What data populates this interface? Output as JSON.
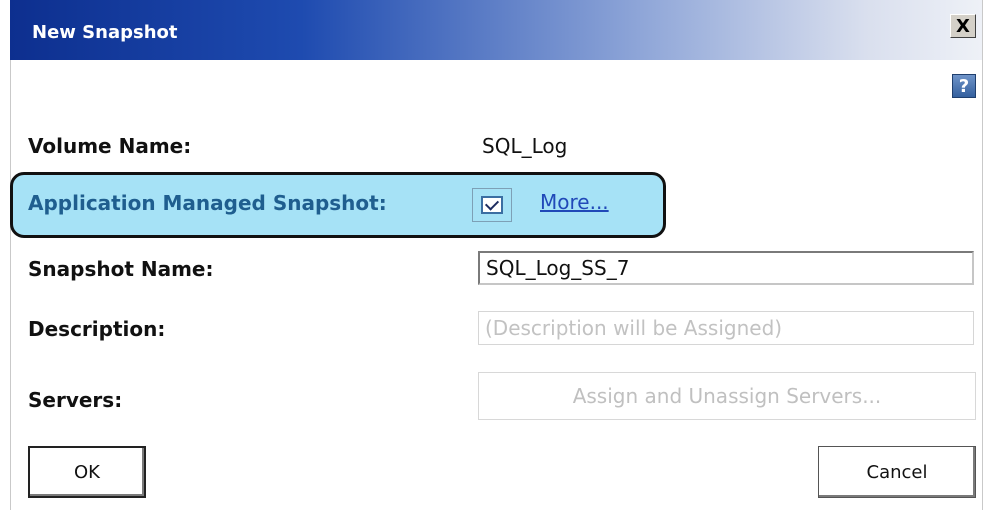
{
  "dialog": {
    "title": "New Snapshot",
    "close_label": "X",
    "help_label": "?"
  },
  "fields": {
    "volume_name": {
      "label": "Volume Name:",
      "value": "SQL_Log"
    },
    "app_managed": {
      "label": "Application Managed Snapshot:",
      "checked": true,
      "more_link": "More..."
    },
    "snapshot_name": {
      "label": "Snapshot Name:",
      "value": "SQL_Log_SS_7"
    },
    "description": {
      "label": "Description:",
      "placeholder": "(Description will be Assigned)"
    },
    "servers": {
      "label": "Servers:",
      "button_label": "Assign and Unassign Servers..."
    }
  },
  "buttons": {
    "ok": "OK",
    "cancel": "Cancel"
  },
  "colors": {
    "titlebar_dark": "#0d2f8f",
    "highlight": "#a6e2f6",
    "blue_label": "#1f5e8f",
    "link": "#2149b8"
  },
  "icons": {
    "close": "close-icon",
    "help": "help-icon",
    "checkbox": "checkbox-checked-icon"
  }
}
